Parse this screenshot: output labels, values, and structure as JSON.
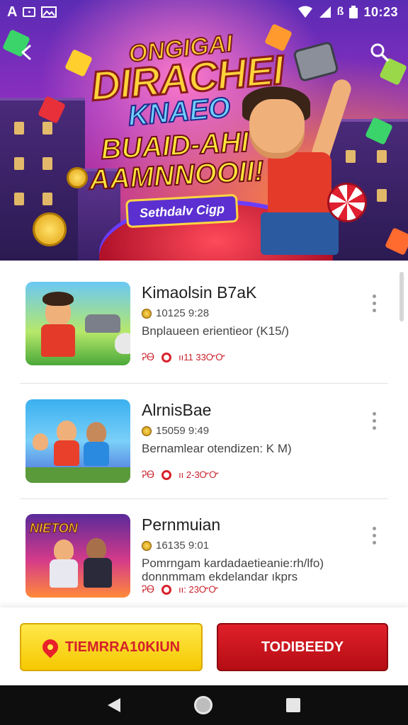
{
  "status_bar": {
    "left_icon_1": "A",
    "left_icon_2": "image-icon",
    "bluetooth": "ß",
    "time": "10:23"
  },
  "hero": {
    "title_top": "ONGIGAI",
    "title_main": "DIRACHEI",
    "title_sub": "KNAEO",
    "headline_line1": "BUAID-AHI",
    "headline_line2": "AAMNNOOII!",
    "pill_text": "Sethdalv Cigp"
  },
  "list": {
    "items": [
      {
        "title": "Kimaolsin B7aK",
        "meta": "10125 9:28",
        "desc": "Bnplaueen erientieor (K15/)",
        "stat1": "ᎮᎾ",
        "stat2": "ıı11 33ᏅᏅ"
      },
      {
        "title": "AlrnisBae",
        "meta": "15059 9:49",
        "desc": "Bernamlear otendizen: K M)",
        "stat1": "ᎮᎾ",
        "stat2": "ıı 2-3ᏅᏅ"
      },
      {
        "title": "Pernmuian",
        "meta": "16135 9:01",
        "desc": "Pomrngam kardadaetieanie:rh/lfo) donnmmam ekdelandar ıkprs",
        "stat1": "ᎮᎾ",
        "stat2": "ıı: 23ᏅᏅ"
      }
    ],
    "thumb_3_word": "NIETON"
  },
  "actions": {
    "primary_label": "TIEMRRA10KIUN",
    "secondary_label": "TODIBEEDY"
  },
  "colors": {
    "accent_red": "#d4202a",
    "accent_yellow": "#f5c800",
    "hero_purple": "#8c2fbf"
  }
}
